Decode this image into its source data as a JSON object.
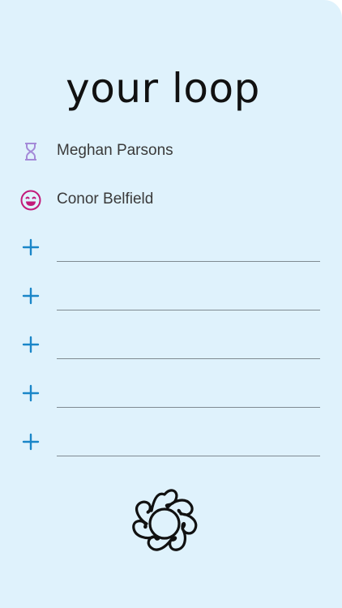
{
  "header": {
    "title": "your loop"
  },
  "members": [
    {
      "name": "Meghan Parsons",
      "status_icon": "hourglass-icon",
      "icon_color": "#a48ad8"
    },
    {
      "name": "Conor Belfield",
      "status_icon": "smiley-icon",
      "icon_color": "#c2197a"
    }
  ],
  "add_slots": [
    {
      "value": "",
      "placeholder": ""
    },
    {
      "value": "",
      "placeholder": ""
    },
    {
      "value": "",
      "placeholder": ""
    },
    {
      "value": "",
      "placeholder": ""
    },
    {
      "value": "",
      "placeholder": ""
    }
  ],
  "colors": {
    "background": "#dff2fc",
    "accent": "#1a86c8",
    "text": "#3a3a3a",
    "title": "#111111"
  },
  "footer": {
    "logo_icon": "loop-logo-icon"
  }
}
